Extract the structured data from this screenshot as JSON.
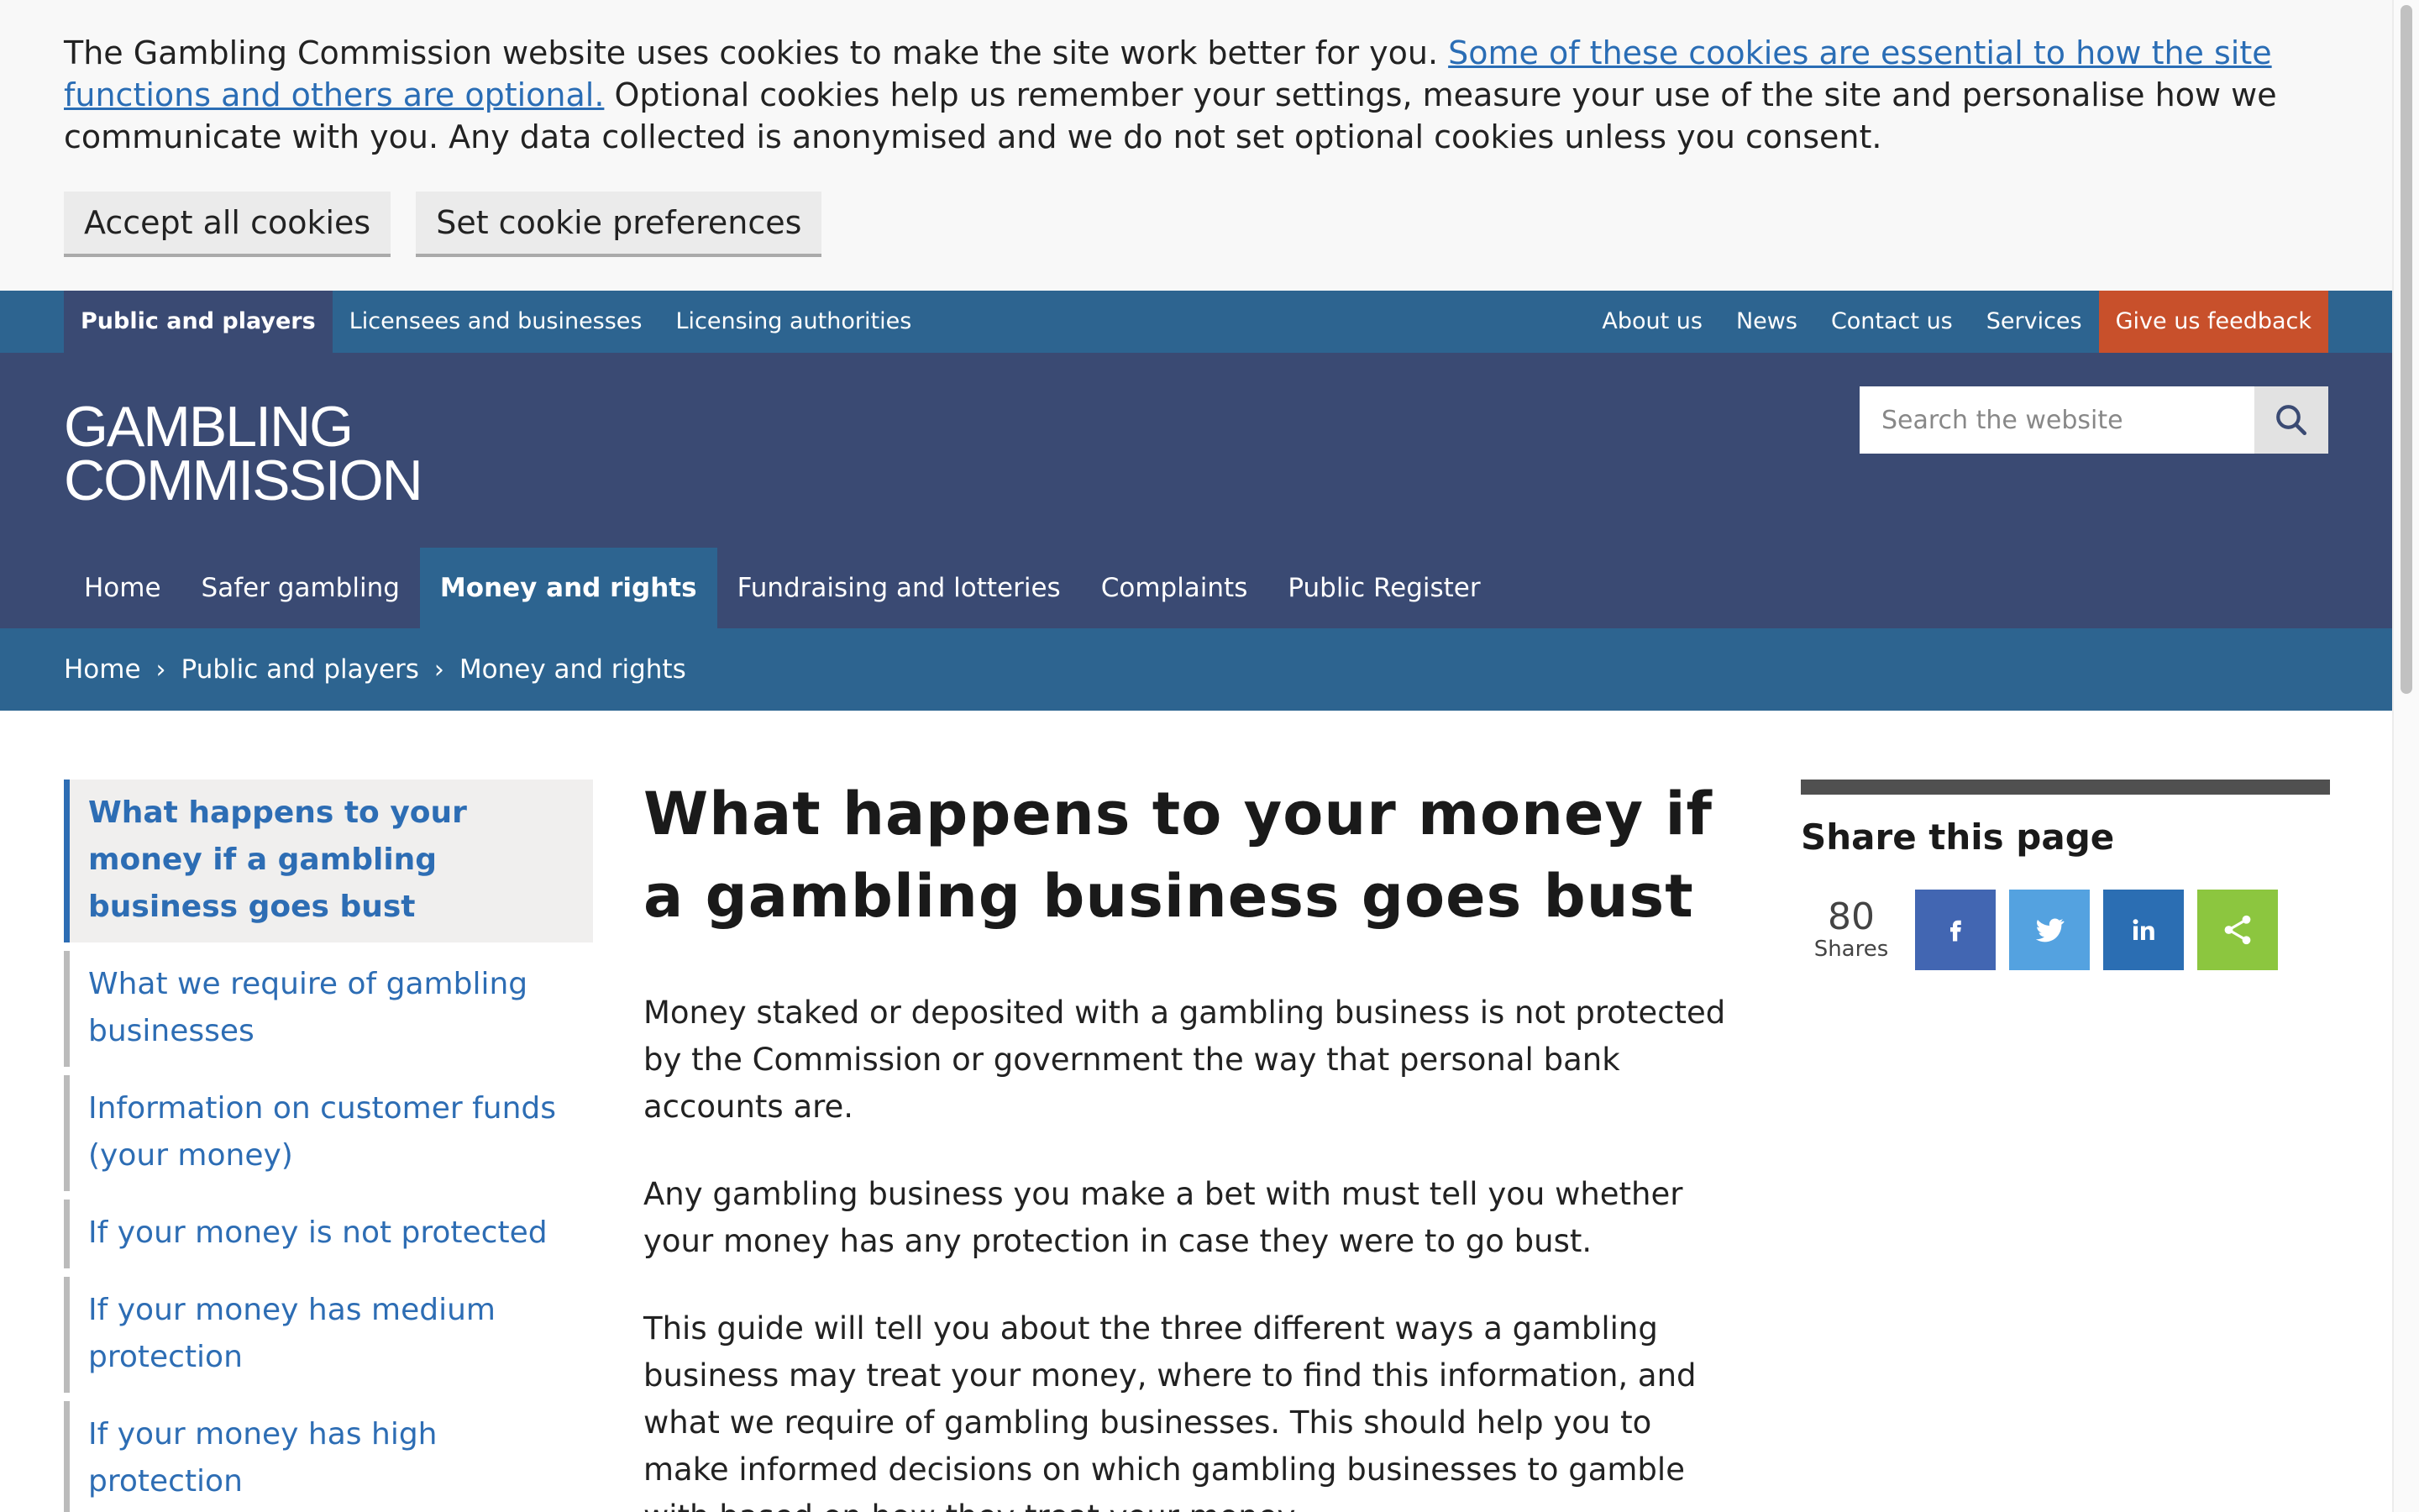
{
  "cookie_banner": {
    "text_before": "The Gambling Commission website uses cookies to make the site work better for you. ",
    "link_text": "Some of these cookies are essential to how the site functions and others are optional.",
    "text_after": " Optional cookies help us remember your settings, measure your use of the site and personalise how we communicate with you. Any data collected is anonymised and we do not set optional cookies unless you consent.",
    "accept_label": "Accept all cookies",
    "preferences_label": "Set cookie preferences"
  },
  "audience_nav": {
    "items": [
      "Public and players",
      "Licensees and businesses",
      "Licensing authorities"
    ],
    "right_items": [
      "About us",
      "News",
      "Contact us",
      "Services"
    ],
    "feedback_label": "Give us feedback"
  },
  "header": {
    "logo_line1": "GAMBLING",
    "logo_line2": "COMMISSION",
    "search_placeholder": "Search the website"
  },
  "main_nav": [
    "Home",
    "Safer gambling",
    "Money and rights",
    "Fundraising and lotteries",
    "Complaints",
    "Public Register"
  ],
  "breadcrumb": [
    "Home",
    "Public and players",
    "Money and rights"
  ],
  "sidebar": [
    "What happens to your money if a gambling business goes bust",
    "What we require of gambling businesses",
    "Information on customer funds (your money)",
    "If your money is not protected",
    "If your money has medium protection",
    "If your money has high protection"
  ],
  "main": {
    "title": "What happens to your money if a gambling business goes bust",
    "paragraphs": [
      "Money staked or deposited with a gambling business is not protected by the Commission or government the way that personal bank accounts are.",
      "Any gambling business you make a bet with must tell you whether your money has any protection in case they were to go bust.",
      "This guide will tell you about the three different ways a gambling business may treat your money, where to find this information, and what we require of gambling businesses. This should help you to make informed decisions on which gambling businesses to gamble with based on how they treat your money."
    ]
  },
  "share": {
    "title": "Share this page",
    "count": "80",
    "count_label": "Shares",
    "buttons": [
      {
        "icon": "facebook-icon",
        "glyph": "f",
        "color": "#4266b2"
      },
      {
        "icon": "twitter-icon",
        "glyph": "🐦",
        "color": "#54a2e0"
      },
      {
        "icon": "linkedin-icon",
        "glyph": "in",
        "color": "#2b6eb3"
      },
      {
        "icon": "share-icon",
        "glyph": "<",
        "color": "#8cc63f"
      }
    ]
  },
  "colors": {
    "audience_bar": "#2d6490",
    "header": "#3a4a73",
    "feedback": "#c8502b",
    "link": "#2d6db4"
  }
}
